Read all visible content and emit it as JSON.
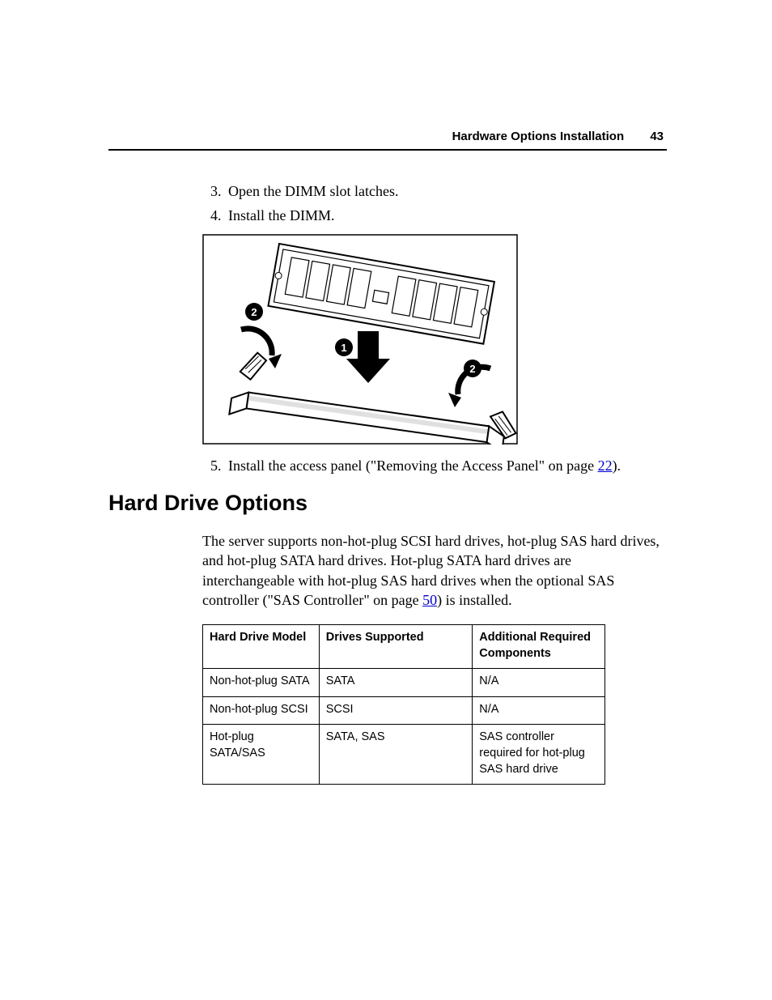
{
  "header": {
    "section": "Hardware Options Installation",
    "page_number": "43"
  },
  "steps_a": {
    "start": 3,
    "items": [
      "Open the DIMM slot latches.",
      "Install the DIMM."
    ]
  },
  "figure": {
    "callouts": {
      "center": "1",
      "left": "2",
      "right": "2"
    }
  },
  "steps_b": {
    "start": 5,
    "item_prefix": "Install the access panel (\"Removing the Access Panel\" on page ",
    "link": "22",
    "item_suffix": ")."
  },
  "section_heading": "Hard Drive Options",
  "section_para": {
    "before_link": "The server supports non-hot-plug SCSI hard drives, hot-plug SAS hard drives, and hot-plug SATA hard drives. Hot-plug SATA hard drives are interchangeable with hot-plug SAS hard drives when the optional SAS controller (\"SAS Controller\" on page ",
    "link": "50",
    "after_link": ") is installed."
  },
  "table": {
    "headers": [
      "Hard Drive Model",
      "Drives Supported",
      "Additional Required Components"
    ],
    "rows": [
      [
        "Non-hot-plug SATA",
        "SATA",
        "N/A"
      ],
      [
        "Non-hot-plug SCSI",
        "SCSI",
        "N/A"
      ],
      [
        "Hot-plug SATA/SAS",
        "SATA, SAS",
        "SAS controller required for hot-plug SAS hard drive"
      ]
    ]
  }
}
